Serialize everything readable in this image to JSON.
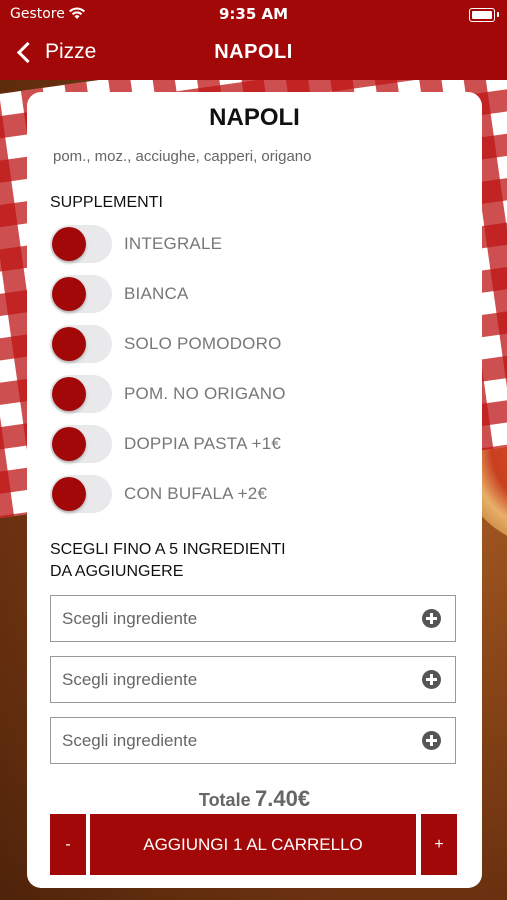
{
  "status_bar": {
    "carrier": "Gestore",
    "time": "9:35 AM"
  },
  "nav": {
    "back_label": "Pizze",
    "title": "NAPOLI"
  },
  "product": {
    "name": "NAPOLI",
    "description": "pom., moz., acciughe, capperi, origano"
  },
  "supplements": {
    "title": "SUPPLEMENTI",
    "items": [
      {
        "label": "INTEGRALE"
      },
      {
        "label": "BIANCA"
      },
      {
        "label": "SOLO POMODORO"
      },
      {
        "label": "POM. NO ORIGANO"
      },
      {
        "label": "DOPPIA PASTA +1€"
      },
      {
        "label": "CON BUFALA +2€"
      }
    ]
  },
  "ingredients": {
    "title_line1": "SCEGLI FINO A 5 INGREDIENTI",
    "title_line2": "DA AGGIUNGERE",
    "pickers": [
      {
        "placeholder": "Scegli ingrediente"
      },
      {
        "placeholder": "Scegli ingrediente"
      },
      {
        "placeholder": "Scegli ingrediente"
      }
    ]
  },
  "total": {
    "label": "Totale",
    "amount": "7.40€"
  },
  "actions": {
    "minus": "-",
    "add": "AGGIUNGI 1 AL CARRELLO",
    "plus": "+"
  },
  "colors": {
    "brand_red": "#a30808",
    "toggle_track": "#e9e9eb"
  }
}
